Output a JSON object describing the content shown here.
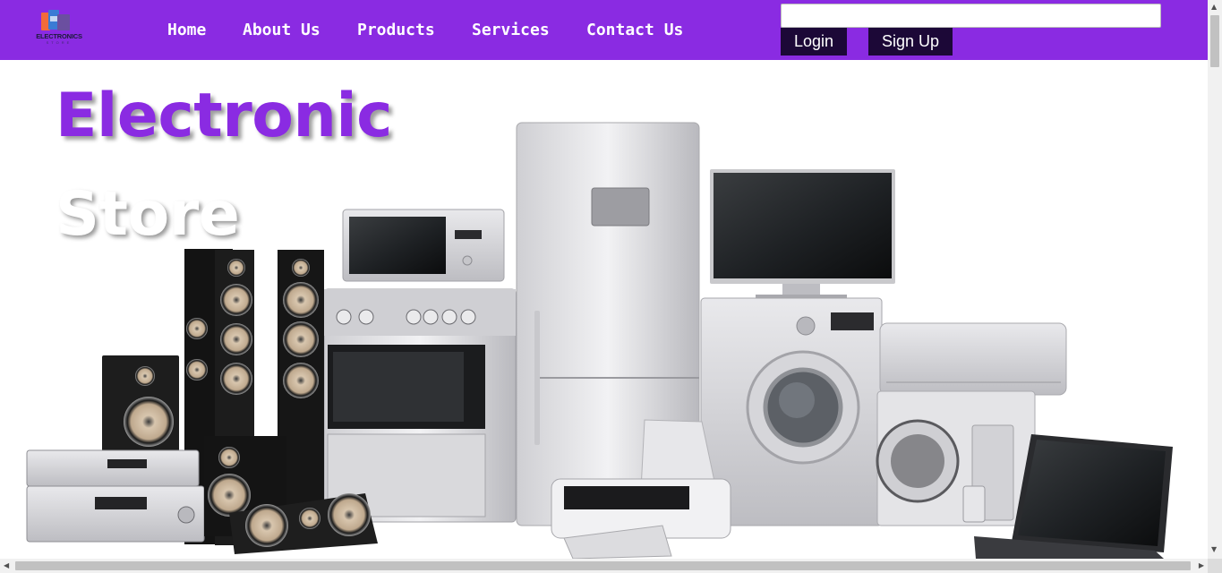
{
  "brand": {
    "logo_text": "ELECTRONICS",
    "logo_subtext": "STORE",
    "accent_color": "#8a2be2",
    "button_color": "#1c0837"
  },
  "nav": {
    "items": [
      {
        "label": "Home"
      },
      {
        "label": "About Us"
      },
      {
        "label": "Products"
      },
      {
        "label": "Services"
      },
      {
        "label": "Contact Us"
      }
    ]
  },
  "search": {
    "value": "",
    "placeholder": ""
  },
  "auth": {
    "login_label": "Login",
    "signup_label": "Sign Up"
  },
  "hero": {
    "title_line1": "Electronic",
    "title_line2": "Store"
  },
  "icons": {
    "scroll_up": "▲",
    "scroll_down": "▼",
    "scroll_left": "◀",
    "scroll_right": "▶"
  }
}
